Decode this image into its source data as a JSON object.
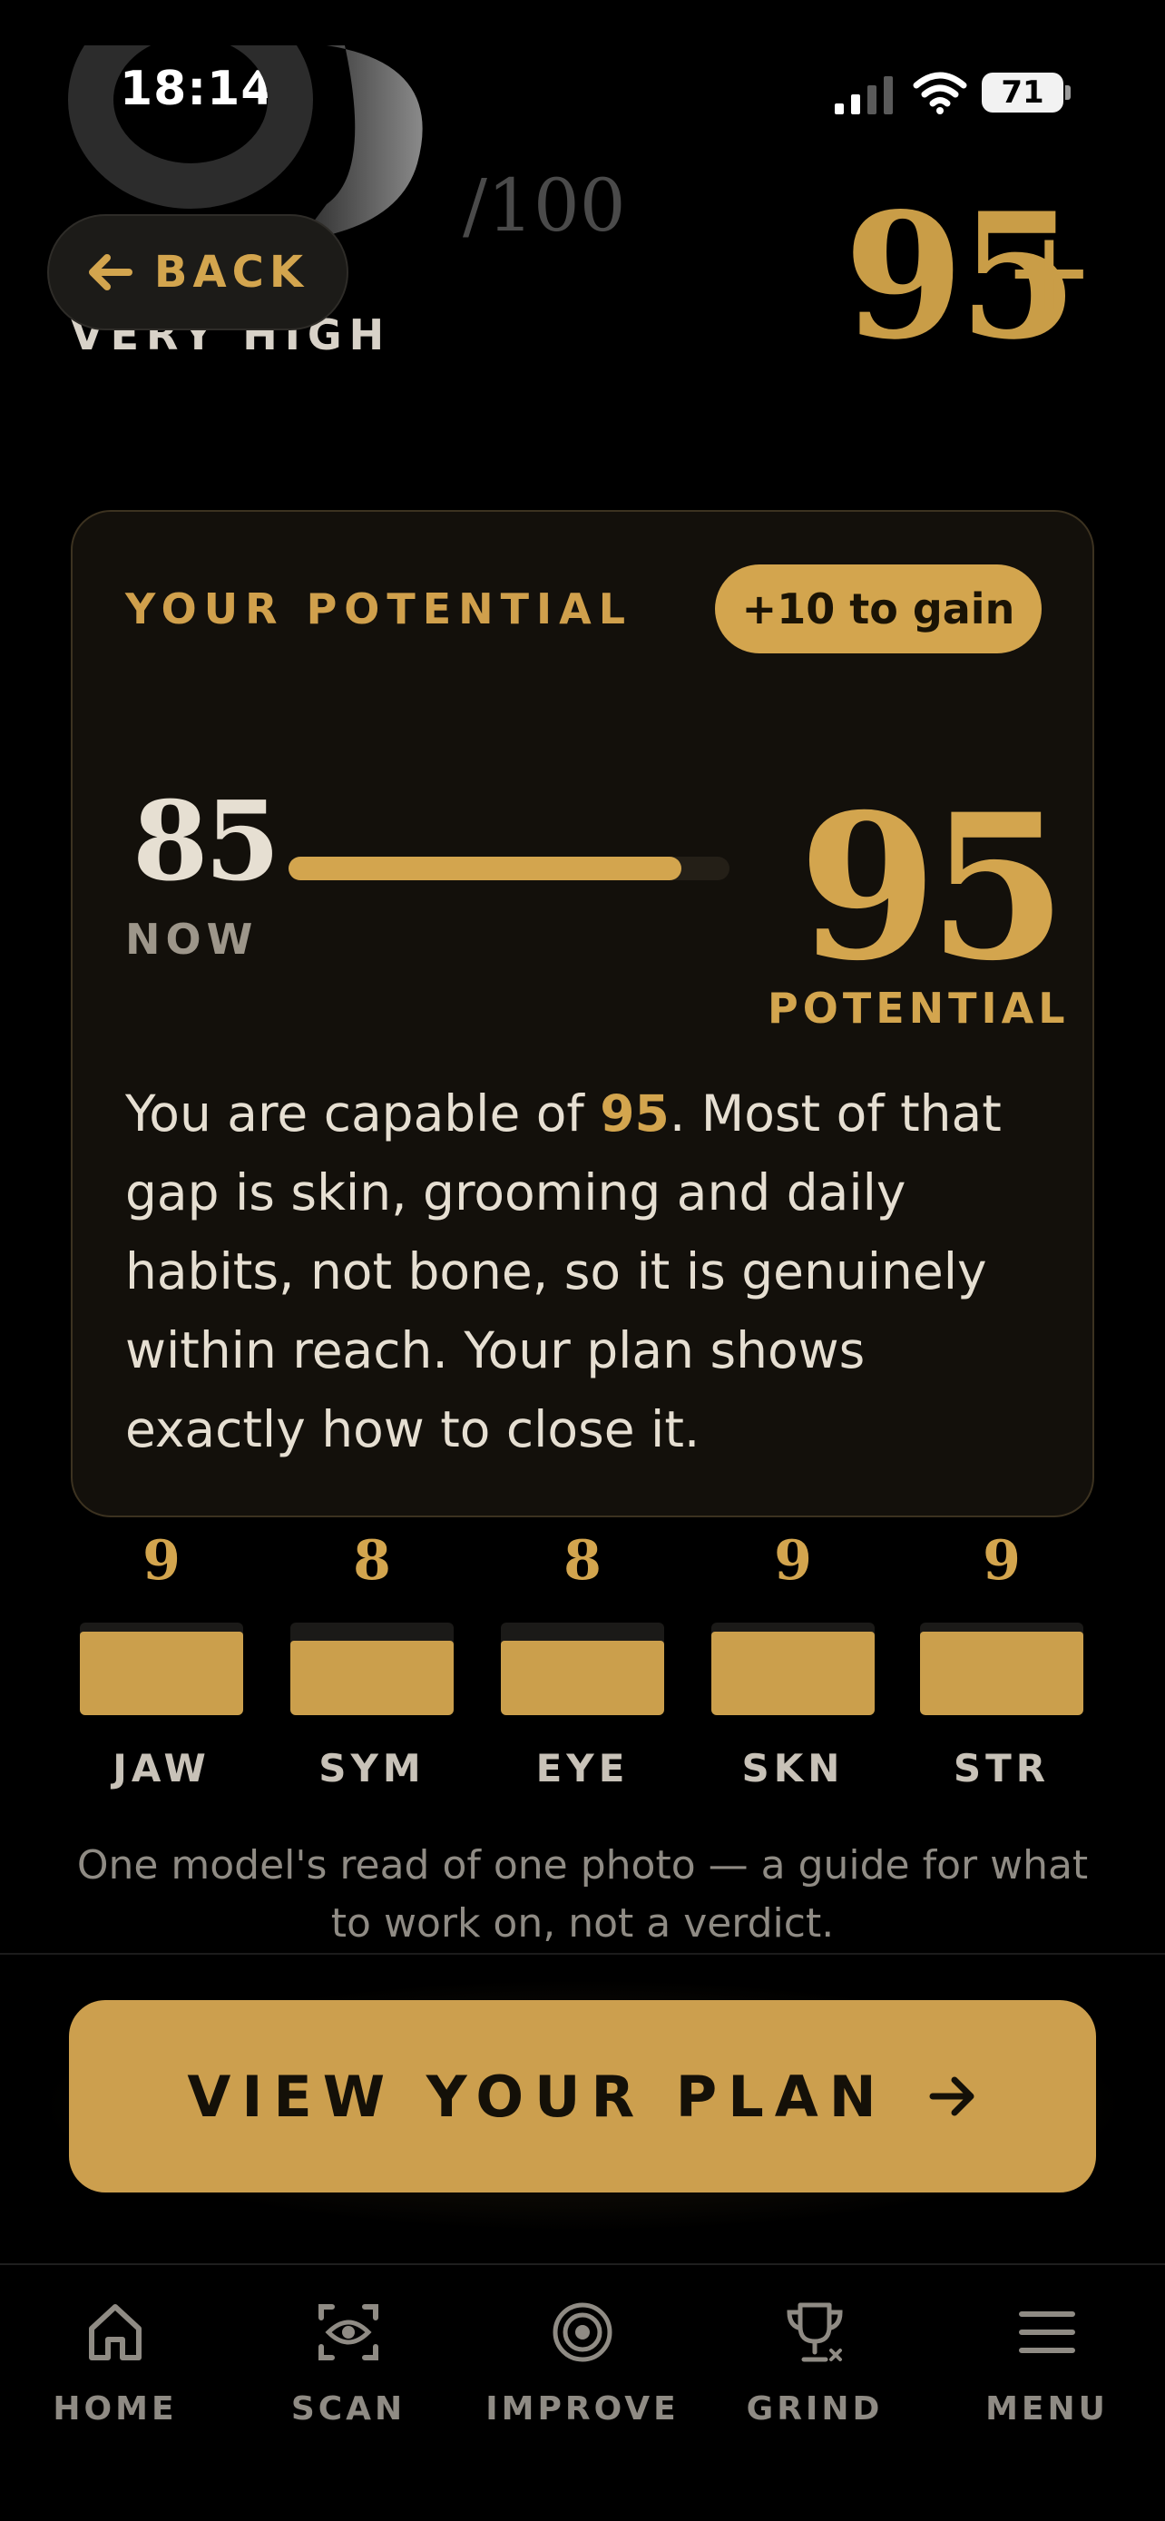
{
  "status_bar": {
    "time": "18:14",
    "battery": "71"
  },
  "header": {
    "current_score_out_of": "/100",
    "rating_label": "VERY HIGH",
    "back_label": "BACK",
    "target_score": "95",
    "target_plus": "+"
  },
  "potential_card": {
    "title": "YOUR POTENTIAL",
    "gain_badge": "+10 to gain",
    "now_value": "85",
    "now_label": "NOW",
    "potential_value": "95",
    "potential_label": "POTENTIAL",
    "progress_fraction": 0.89,
    "description_before": "You are capable of ",
    "description_highlight": "95",
    "description_after": ". Most of that gap is skin, grooming and daily habits, not bone, so it is genuinely within reach. Your plan shows exactly how to close it."
  },
  "sub_scores": [
    {
      "label": "JAW",
      "value": "9",
      "fill_fraction": 0.9
    },
    {
      "label": "SYM",
      "value": "8",
      "fill_fraction": 0.8
    },
    {
      "label": "EYE",
      "value": "8",
      "fill_fraction": 0.8
    },
    {
      "label": "SKN",
      "value": "9",
      "fill_fraction": 0.9
    },
    {
      "label": "STR",
      "value": "9",
      "fill_fraction": 0.9
    }
  ],
  "disclaimer": "One model's read of one photo — a guide for what to work on, not a verdict.",
  "cta": {
    "label": "VIEW YOUR PLAN"
  },
  "tab_bar": [
    {
      "label": "HOME",
      "icon": "home-icon"
    },
    {
      "label": "SCAN",
      "icon": "scan-face-icon"
    },
    {
      "label": "IMPROVE",
      "icon": "target-icon"
    },
    {
      "label": "GRIND",
      "icon": "trophy-icon"
    },
    {
      "label": "MENU",
      "icon": "menu-icon"
    }
  ],
  "colors": {
    "accent": "#d3a54e",
    "background": "#000000",
    "card": "#13100b"
  }
}
